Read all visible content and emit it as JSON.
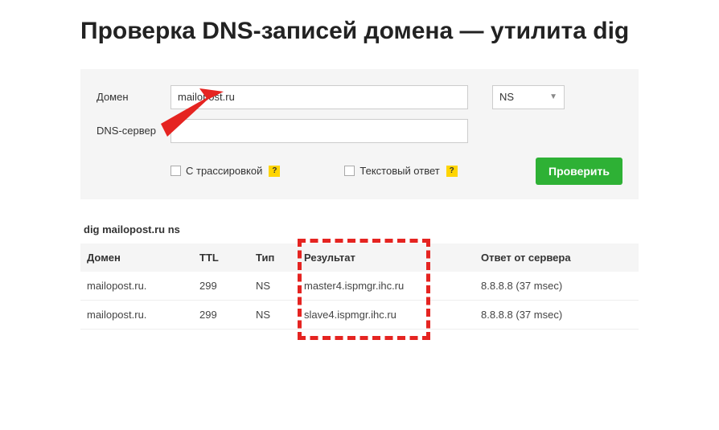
{
  "title": "Проверка DNS-записей домена — утилита dig",
  "form": {
    "domain_label": "Домен",
    "domain_value": "mailopost.ru",
    "dns_label": "DNS-сервер",
    "dns_value": "",
    "record_type": "NS",
    "trace_label": "С трассировкой",
    "text_label": "Текстовый ответ",
    "help_symbol": "?",
    "submit_label": "Проверить"
  },
  "result_cmd": "dig mailopost.ru ns",
  "table": {
    "headers": {
      "domain": "Домен",
      "ttl": "TTL",
      "type": "Тип",
      "result": "Результат",
      "server": "Ответ от сервера"
    },
    "rows": [
      {
        "domain": "mailopost.ru.",
        "ttl": "299",
        "type": "NS",
        "result": "master4.ispmgr.ihc.ru",
        "server": "8.8.8.8 (37 msec)"
      },
      {
        "domain": "mailopost.ru.",
        "ttl": "299",
        "type": "NS",
        "result": "slave4.ispmgr.ihc.ru",
        "server": "8.8.8.8 (37 msec)"
      }
    ]
  },
  "annotations": {
    "arrow_color": "#e52421",
    "highlight_color": "#e52421"
  }
}
